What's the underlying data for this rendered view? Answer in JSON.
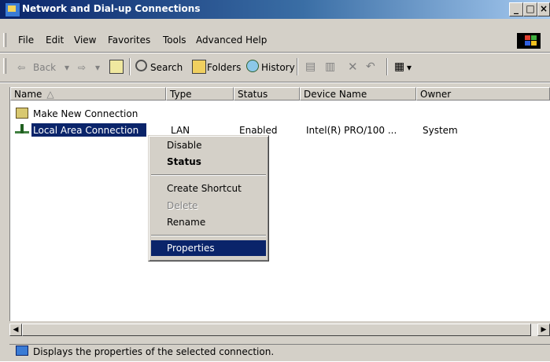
{
  "window": {
    "title": "Network and Dial-up Connections"
  },
  "menu": [
    "File",
    "Edit",
    "View",
    "Favorites",
    "Tools",
    "Advanced",
    "Help"
  ],
  "toolbar": {
    "back": "Back",
    "search": "Search",
    "folders": "Folders",
    "history": "History"
  },
  "columns": [
    "Name",
    "Type",
    "Status",
    "Device Name",
    "Owner"
  ],
  "items": [
    {
      "name": "Make New Connection"
    },
    {
      "name": "Local Area Connection",
      "type": "LAN",
      "status": "Enabled",
      "device": "Intel(R) PRO/100 ...",
      "owner": "System"
    }
  ],
  "context_menu": {
    "disable": "Disable",
    "status": "Status",
    "create_shortcut": "Create Shortcut",
    "delete": "Delete",
    "rename": "Rename",
    "properties": "Properties"
  },
  "status_bar": {
    "text": "Displays the properties of the selected connection."
  },
  "colors": {
    "title_start": "#0a246a",
    "title_end": "#a6caf0",
    "selection": "#0a246a",
    "chrome": "#d4d0c8"
  }
}
